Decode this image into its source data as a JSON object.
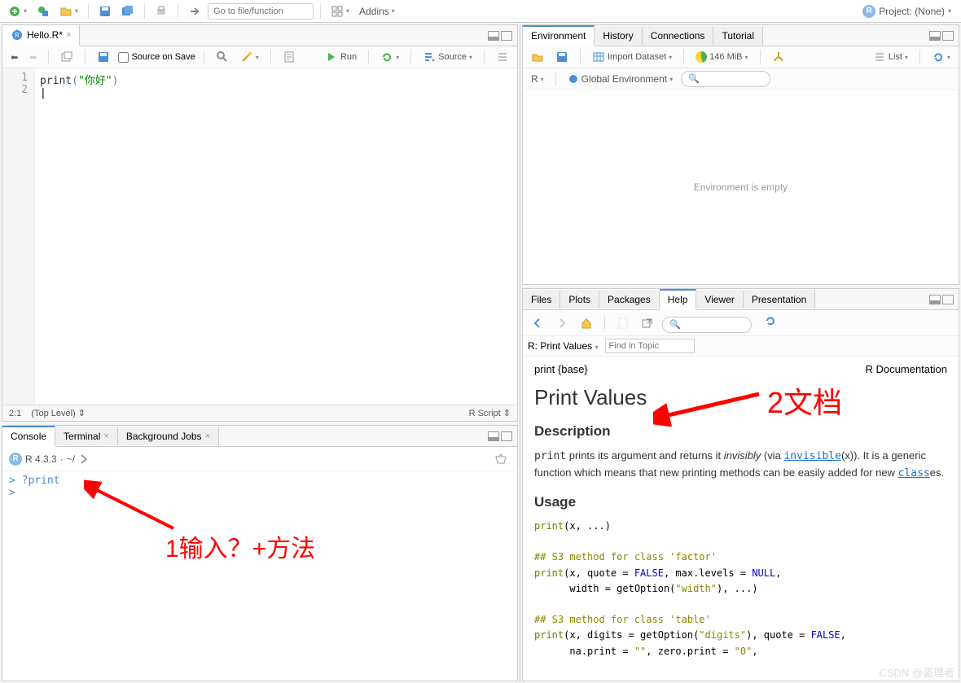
{
  "toolbar": {
    "goto_placeholder": "Go to file/function",
    "addins_label": "Addins",
    "project_label": "Project: (None)"
  },
  "source": {
    "tab_name": "Hello.R*",
    "source_on_save": "Source on Save",
    "run_label": "Run",
    "source_label": "Source",
    "line_numbers": [
      "1",
      "2"
    ],
    "code_fn": "print",
    "code_str": "\"你好\"",
    "status_pos": "2:1",
    "status_scope": "(Top Level)",
    "status_type": "R Script"
  },
  "console": {
    "tabs": [
      "Console",
      "Terminal",
      "Background Jobs"
    ],
    "r_version": "R 4.3.3",
    "path": "~/",
    "prompt": ">",
    "cmd": "?print"
  },
  "env": {
    "tabs": [
      "Environment",
      "History",
      "Connections",
      "Tutorial"
    ],
    "import_label": "Import Dataset",
    "memory": "146 MiB",
    "list_label": "List",
    "r_dropdown": "R",
    "global_env": "Global Environment",
    "empty_msg": "Environment is empty"
  },
  "help": {
    "tabs": [
      "Files",
      "Plots",
      "Packages",
      "Help",
      "Viewer",
      "Presentation"
    ],
    "breadcrumb": "R: Print Values",
    "find_placeholder": "Find in Topic",
    "pkg_header": "print {base}",
    "doc_label": "R Documentation",
    "title": "Print Values",
    "h_desc": "Description",
    "desc_text1": "print",
    "desc_text2": " prints its argument and returns it ",
    "desc_text3": "invisibly",
    "desc_text4": " (via ",
    "desc_link1": "invisible",
    "desc_text5": "(x)). It is a generic function which means that new printing methods can be easily added for new ",
    "desc_link2": "class",
    "desc_text6": "es.",
    "h_usage": "Usage",
    "usage_lines": {
      "l1a": "print",
      "l1b": "(x, ...)",
      "c1": "## S3 method for class 'factor'",
      "l2a": "print",
      "l2b": "(x, quote = ",
      "l2c": "FALSE",
      "l2d": ", max.levels = ",
      "l2e": "NULL",
      "l2f": ",",
      "l3a": "      width = getOption(",
      "l3b": "\"width\"",
      "l3c": "), ...)",
      "c2": "## S3 method for class 'table'",
      "l4a": "print",
      "l4b": "(x, digits = getOption(",
      "l4c": "\"digits\"",
      "l4d": "), quote = ",
      "l4e": "FALSE",
      "l4f": ",",
      "l5a": "      na.print = ",
      "l5b": "\"\"",
      "l5c": ", zero.print = ",
      "l5d": "\"0\"",
      "l5e": ","
    }
  },
  "annotations": {
    "a1": "1输入？+方法",
    "a2": "2文档"
  },
  "watermark": "CSDN @盗理者"
}
